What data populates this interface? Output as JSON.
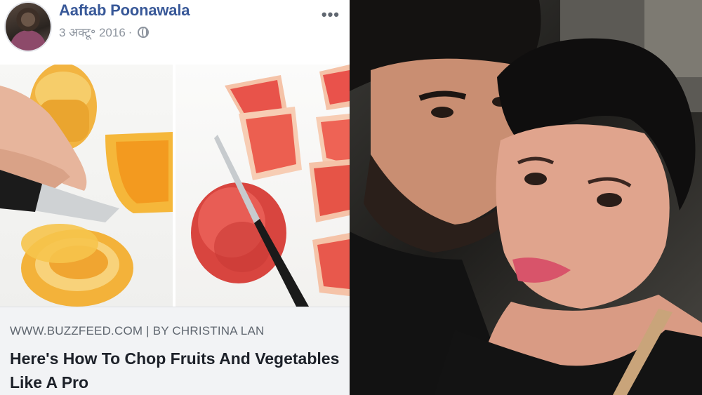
{
  "post": {
    "author": "Aaftab Poonawala",
    "date": "3 अक्टू॰ 2016",
    "separator": "·",
    "more_label": "•••",
    "link": {
      "domain": "WWW.BUZZFEED.COM | BY CHRISTINA LAN",
      "title": "Here's How To Chop Fruits And Vegetables Like A Pro"
    }
  },
  "icons": {
    "avatar": "profile-avatar",
    "privacy": "globe-icon",
    "more": "more-options-icon"
  },
  "colors": {
    "author_link": "#385898",
    "meta_text": "#8d949e",
    "link_box_bg": "#f2f3f5",
    "title_text": "#1d2129"
  }
}
